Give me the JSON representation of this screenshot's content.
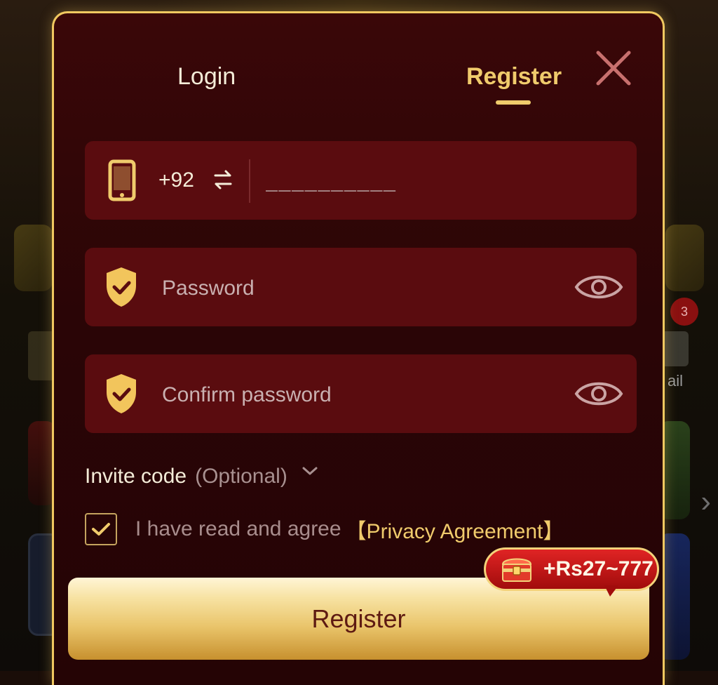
{
  "tabs": {
    "login_label": "Login",
    "register_label": "Register"
  },
  "phone": {
    "country_code": "+92",
    "placeholder": "__________"
  },
  "password": {
    "placeholder": "Password"
  },
  "confirm_password": {
    "placeholder": "Confirm password"
  },
  "invite": {
    "label": "Invite code",
    "optional_label": "(Optional)"
  },
  "agreement": {
    "text": "I have read and agree",
    "link": "【Privacy Agreement】",
    "checked": true
  },
  "register_button_label": "Register",
  "bonus": {
    "text": "+Rs27~777"
  },
  "background": {
    "badge_count": "3",
    "partial_label": "ail"
  },
  "colors": {
    "accent_gold": "#f0cb6c",
    "field_bg": "#5a0c0f",
    "modal_bg": "#2a0506"
  },
  "icons": [
    "phone-icon",
    "swap-icon",
    "shield-check-icon",
    "eye-icon",
    "close-icon",
    "chevron-down-icon",
    "check-icon",
    "treasure-chest-icon"
  ]
}
